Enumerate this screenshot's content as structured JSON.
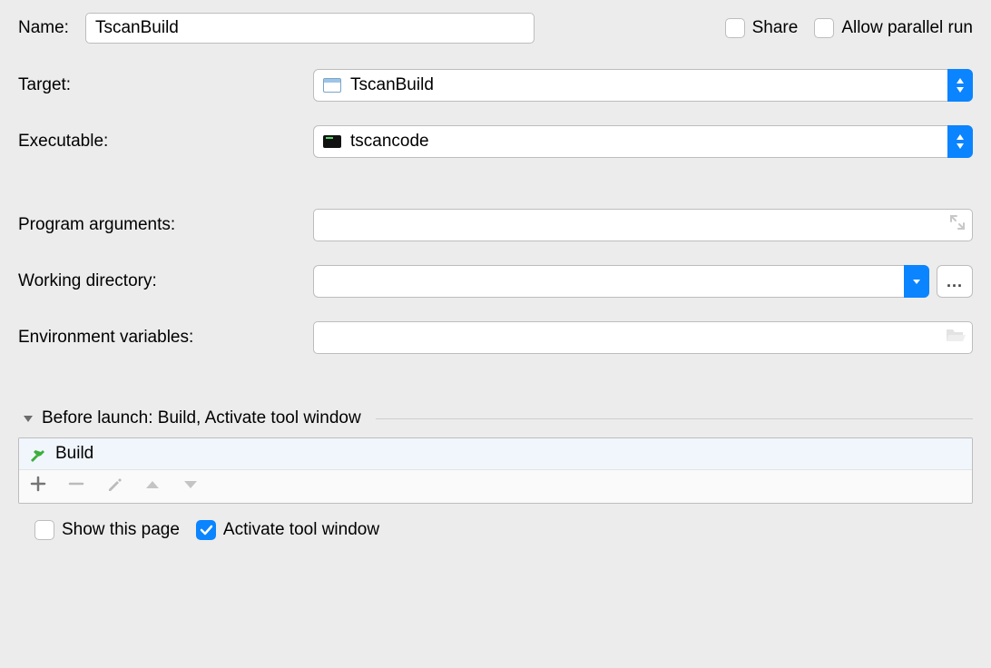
{
  "name": {
    "label": "Name:",
    "value": "TscanBuild"
  },
  "share": {
    "label": "Share",
    "checked": false
  },
  "allow_parallel": {
    "label": "Allow parallel run",
    "checked": false
  },
  "target": {
    "label": "Target:",
    "value": "TscanBuild"
  },
  "executable": {
    "label": "Executable:",
    "value": "tscancode"
  },
  "program_arguments": {
    "label": "Program arguments:",
    "value": ""
  },
  "working_directory": {
    "label": "Working directory:",
    "value": ""
  },
  "env_vars": {
    "label": "Environment variables:",
    "value": ""
  },
  "section_title": "Before launch: Build, Activate tool window",
  "tasks": [
    {
      "label": "Build"
    }
  ],
  "browse_label": "...",
  "show_page": {
    "label": "Show this page",
    "checked": false
  },
  "activate_tool_window": {
    "label": "Activate tool window",
    "checked": true
  }
}
